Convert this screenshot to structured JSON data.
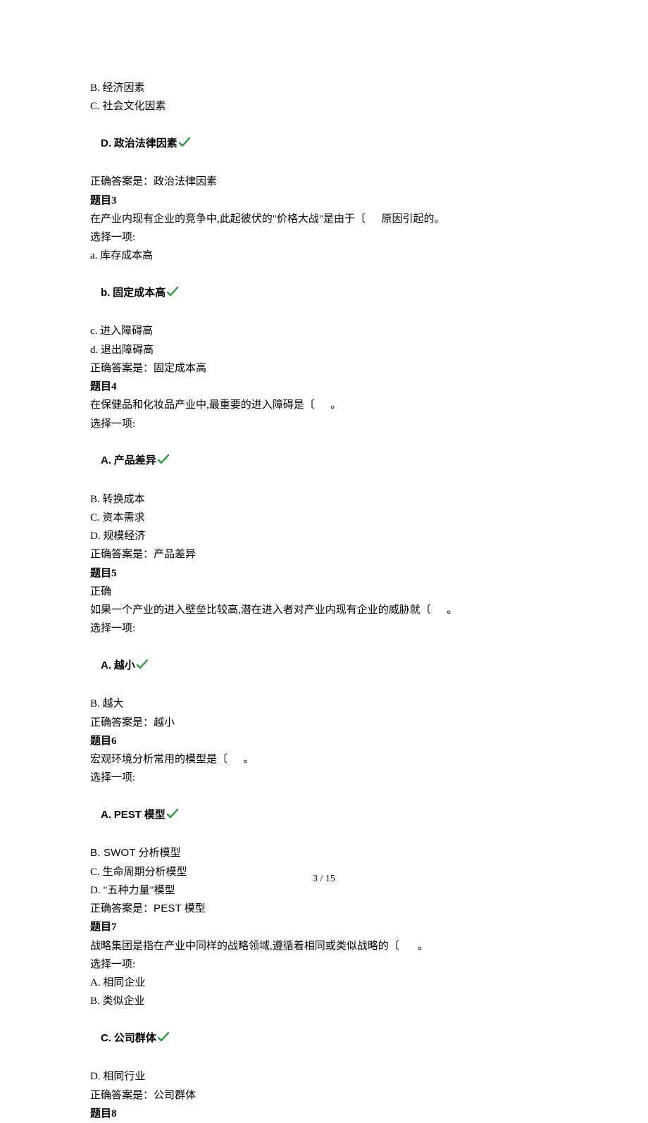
{
  "q2": {
    "optB": "B. 经济因素",
    "optC": "C. 社会文化因素",
    "optD_prefix": "D.",
    "optD_label": "政治法律因素",
    "answer": "正确答案是：政治法律因素"
  },
  "q3": {
    "title": "题目3",
    "stem": "在产业内现有企业的竞争中,此起彼伏的\"价格大战\"是由于〔      原因引起的。",
    "choose": "选择一项:",
    "optA": "a. 库存成本高",
    "optB_prefix": "b.",
    "optB_label": "固定成本高",
    "optC": "c. 进入障碍高",
    "optD": "d. 退出障碍高",
    "answer": "正确答案是：固定成本高"
  },
  "q4": {
    "title": "题目4",
    "stem": "在保健品和化妆品产业中,最重要的进入障碍是〔      。",
    "choose": "选择一项:",
    "optA_prefix": "A.",
    "optA_label": "产品差异",
    "optB": "B. 转换成本",
    "optC": "C. 资本需求",
    "optD": "D. 规模经济",
    "answer": "正确答案是：产品差异"
  },
  "q5": {
    "title": "题目5",
    "correct": "正确",
    "stem": "如果一个产业的进入壁垒比较高,潜在进入者对产业内现有企业的威胁就〔      。",
    "choose": "选择一项:",
    "optA_prefix": "A.",
    "optA_label": "越小",
    "optB": "B. 越大",
    "answer": "正确答案是：越小"
  },
  "q6": {
    "title": "题目6",
    "stem": "宏观环境分析常用的模型是〔      。",
    "choose": "选择一项:",
    "optA_prefix": "A.",
    "optA_mid": "PEST",
    "optA_suffix": "模型",
    "optB_prefix": "B. ",
    "optB_mid": "SWOT",
    "optB_suffix": " 分析模型",
    "optC": "C. 生命周期分析模型",
    "optD": "D. \"五种力量\"模型",
    "answer_prefix": "正确答案是：",
    "answer_mid": "PEST",
    "answer_suffix": " 模型"
  },
  "q7": {
    "title": "题目7",
    "stem": "战略集团是指在产业中同样的战略领域,遵循着相同或类似战略的〔       。",
    "choose": "选择一项:",
    "optA": "A. 相同企业",
    "optB": "B. 类似企业",
    "optC_prefix": "C.",
    "optC_label": "公司群体",
    "optD": "D. 相同行业",
    "answer": "正确答案是：公司群体"
  },
  "q8": {
    "title": "题目8"
  },
  "footer": "3 / 15"
}
